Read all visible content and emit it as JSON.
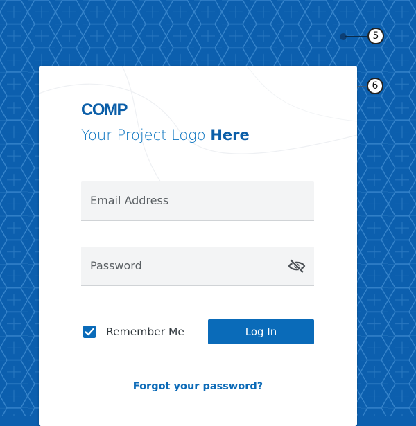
{
  "colors": {
    "background": "#0c5fae",
    "pattern_line": "#3d8ad0",
    "brand_blue": "#0b5ea8",
    "accent_blue": "#0a6bb9",
    "card": "#ffffff",
    "field_bg": "#f3f4f5"
  },
  "callouts": [
    {
      "number": "5"
    },
    {
      "number": "6"
    }
  ],
  "logo": {
    "mark": "COMP",
    "tagline_prefix": "Your Project Logo ",
    "tagline_bold": "Here"
  },
  "form": {
    "email": {
      "placeholder": "Email Address"
    },
    "password": {
      "placeholder": "Password",
      "toggle_icon": "eye-slash-icon"
    },
    "remember": {
      "label": "Remember Me",
      "checked": true,
      "icon": "checkmark-icon"
    },
    "login_label": "Log In",
    "forgot_label": "Forgot your password?"
  }
}
